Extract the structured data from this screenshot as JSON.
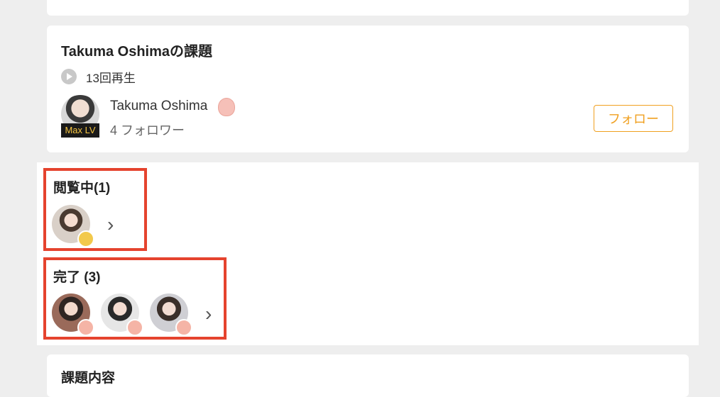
{
  "assignment": {
    "title": "Takuma Oshimaの課題",
    "plays": "13回再生",
    "author": {
      "name": "Takuma Oshima",
      "level_badge": "Max LV",
      "followers": "4 フォロワー"
    },
    "follow_label": "フォロー"
  },
  "viewing": {
    "title": "閲覧中(1)"
  },
  "completed": {
    "title": "完了 (3)"
  },
  "content": {
    "title": "課題内容"
  },
  "colors": {
    "accent": "#f0a020",
    "highlight": "#e5432e"
  }
}
